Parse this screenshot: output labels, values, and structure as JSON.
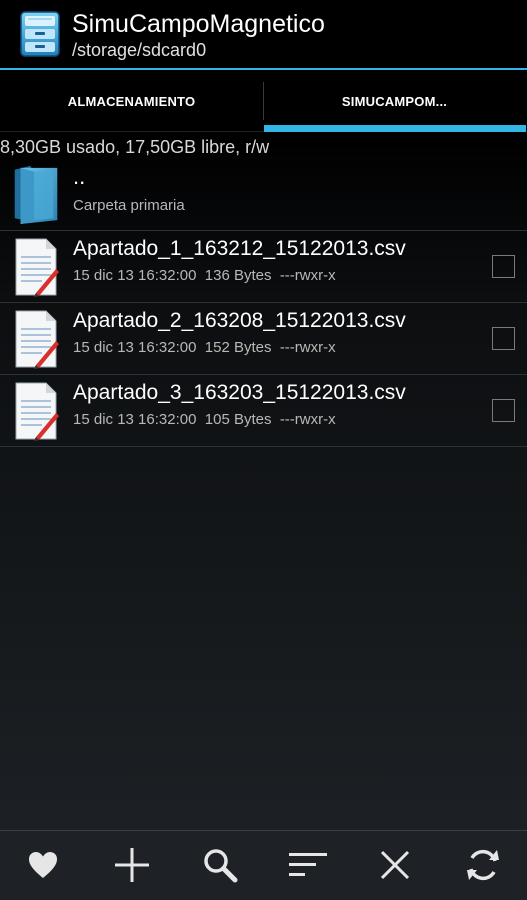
{
  "header": {
    "title": "SimuCampoMagnetico",
    "path": "/storage/sdcard0",
    "icon": "file-manager-icon"
  },
  "tabs": [
    {
      "label": "ALMACENAMIENTO",
      "active": false
    },
    {
      "label": "SIMUCAMPOM...",
      "active": true
    }
  ],
  "storage_info": "8,30GB usado, 17,50GB libre, r/w",
  "parent": {
    "name": "..",
    "description": "Carpeta primaria",
    "icon": "folder-icon"
  },
  "files": [
    {
      "name": "Apartado_1_163212_15122013.csv",
      "meta": "15 dic 13 16:32:00  136 Bytes  ---rwxr-x",
      "checked": false,
      "icon": "text-file-icon"
    },
    {
      "name": "Apartado_2_163208_15122013.csv",
      "meta": "15 dic 13 16:32:00  152 Bytes  ---rwxr-x",
      "checked": false,
      "icon": "text-file-icon"
    },
    {
      "name": "Apartado_3_163203_15122013.csv",
      "meta": "15 dic 13 16:32:00  105 Bytes  ---rwxr-x",
      "checked": false,
      "icon": "text-file-icon"
    }
  ],
  "bottom_bar": [
    "heart-icon",
    "plus-icon",
    "search-icon",
    "sort-icon",
    "close-icon",
    "refresh-icon"
  ],
  "colors": {
    "accent": "#33b5e5",
    "background": "#000000",
    "bottom_bar": "#1e2226"
  }
}
